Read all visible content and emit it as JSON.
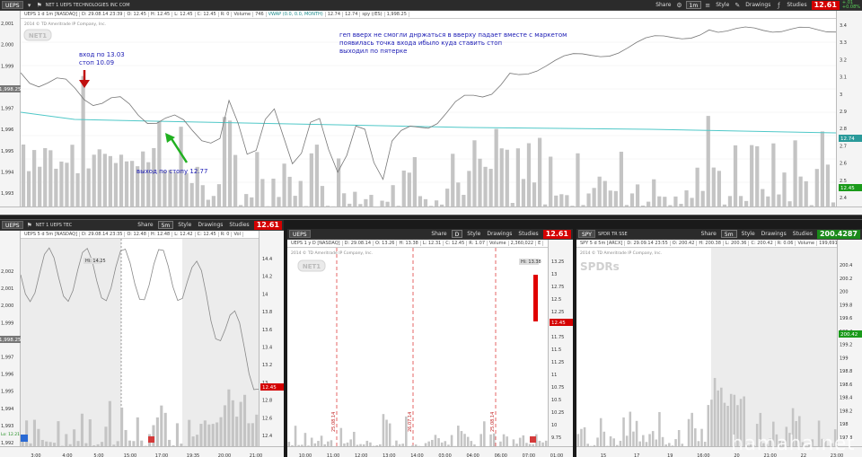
{
  "colors": {
    "up": "#10c010",
    "down": "#e00000",
    "price_tag": "#d40000",
    "mav": "#50c8c8",
    "annotation": "#1a1ab4",
    "arrow_red": "#c01010",
    "arrow_green": "#20b020"
  },
  "main": {
    "toolbar": {
      "symbol": "UEPS",
      "name": "NET 1 UEPS TECHNOLOGIES INC COM",
      "share": "Share",
      "aggregation": "1m",
      "style": "Style",
      "drawings": "Drawings",
      "studies": "Studies",
      "price": "12.61",
      "change": "+.01",
      "change_pct": "+0.08%"
    },
    "infobar": [
      "UEPS 1 d 1m [NASDAQ]",
      "D: 29.08.14 23:39",
      "O: 12.45",
      "H: 12.45",
      "L: 12.45",
      "C: 12.45",
      "R: 0",
      "Volume",
      "746",
      "VWAP (0.0, 0.0, MONTH)",
      "12.74",
      "12.74",
      "spy (/ES)",
      "1,998.25"
    ],
    "logo": "NET1",
    "copyright": "2014 © TD Ameritrade IP Company, Inc.",
    "left_ticks": [
      "2,001",
      "2,000",
      "1,999",
      "1,998",
      "1,997",
      "1,996",
      "1,995",
      "1,994",
      "1,993"
    ],
    "left_tag": "1,998.25",
    "right_ticks": [
      "3.4",
      "3.3",
      "3.2",
      "3.1",
      "3",
      "2.9",
      "2.8",
      "2.7",
      "2.6",
      "2.5",
      "2.4"
    ],
    "mav_tag": "12.74",
    "price_tag": "12.45",
    "time_ticks": [
      "19:35",
      "19:40",
      "19:45",
      "19:50",
      "19:55",
      "20:00",
      "20:05",
      "20:10",
      "20:15",
      "20:20",
      "20:25",
      "20:30",
      "20:35",
      "20:40",
      "20:45",
      "20:50",
      "20:55",
      "21:00",
      "21:05",
      "21:10",
      "21:15",
      "21:20",
      "21:25",
      "21:30",
      "21:35",
      "21:40",
      "21:45",
      "21:50",
      "21:55"
    ],
    "note_entry": [
      "вход по 13.03",
      "стоп 10.09"
    ],
    "note_top": [
      "геп вверх не смогли днржаться в вверху падает вместе с маркетом",
      "появилась точка входа ибыло куда ставить стоп",
      "выходил по пятерке"
    ],
    "note_exit": "выход по стопу 12.77"
  },
  "panel1": {
    "toolbar": {
      "symbol": "UEPS",
      "name": "NET 1 UEPS TEC",
      "share": "Share",
      "aggregation": "5m",
      "style": "Style",
      "drawings": "Drawings",
      "studies": "Studies",
      "price": "12.61"
    },
    "infobar": [
      "UEPS 5 d 5m [NASDAQ]",
      "D: 29.08.14 23:35",
      "O: 12.48",
      "H: 12.48",
      "L: 12.42",
      "C: 12.45",
      "R: 0",
      "Vol"
    ],
    "copyright": "2014 © TD Ameritrade IP Company, Inc.",
    "logo": "NET1",
    "left_ticks": [
      "2,002",
      "2,001",
      "2,000",
      "1,999",
      "1,998",
      "1,997",
      "1,996",
      "1,995",
      "1,994",
      "1,993",
      "1,992"
    ],
    "left_tag": "1,998.25",
    "right_ticks": [
      "14.4",
      "14.2",
      "14",
      "13.8",
      "13.6",
      "13.4",
      "13.2",
      "13",
      "12.8",
      "12.6",
      "12.4"
    ],
    "hi_label": "Hi: 14.25",
    "price_tag": "12.45",
    "time_ticks": [
      "3:00",
      "4:00",
      "5:00",
      "15:00",
      "17:00",
      "19:35",
      "20:00",
      "21:00"
    ],
    "bottom_label": "Lo: 12.21"
  },
  "panel2": {
    "toolbar": {
      "symbol": "UEPS",
      "share": "Share",
      "aggregation": "D",
      "style": "Style",
      "drawings": "Drawings",
      "studies": "Studies",
      "price": "12.61"
    },
    "infobar": [
      "UEPS 1 y D [NASDAQ]",
      "D: 29.08.14",
      "O: 13.26",
      "H: 13.38",
      "L: 12.31",
      "C: 12.45",
      "R: 1.07",
      "Volume",
      "2,360,022",
      "E"
    ],
    "copyright": "2014 © TD Ameritrade IP Company, Inc.",
    "logo": "NET1",
    "right_ticks": [
      "13.25",
      "13",
      "12.75",
      "12.5",
      "12.25",
      "12",
      "11.75",
      "11.5",
      "11.25",
      "11",
      "10.75",
      "10.5",
      "10.25",
      "10",
      "9.75"
    ],
    "hi_label": "Hi: 13.38",
    "price_tag": "12.45",
    "time_ticks": [
      "10:00",
      "11:00",
      "12:00",
      "13:00",
      "14:00",
      "03:00",
      "04:00",
      "06:00",
      "07:00",
      "01:00"
    ],
    "date_labels": [
      "25.08.14",
      "26.07.14",
      "25.08.14"
    ]
  },
  "panel3": {
    "toolbar": {
      "symbol": "SPY",
      "name": "SPDR TR SSE",
      "share": "Share",
      "aggregation": "5m",
      "style": "Style",
      "drawings": "Drawings",
      "studies": "Studies",
      "price": "200.4287",
      "change": "+.597",
      "change_pct": "+0.30%"
    },
    "infobar": [
      "SPY 5 d 5m [ARCX]",
      "D: 29.09.14 23:55",
      "O: 200.42",
      "H: 200.38",
      "L: 200.36",
      "C: 200.42",
      "R: 0.06",
      "Volume",
      "199,691"
    ],
    "copyright": "2014 © TD Ameritrade IP Company, Inc.",
    "logo": "SPDRs",
    "right_ticks": [
      "200.4",
      "200.2",
      "200",
      "199.8",
      "199.6",
      "199.4",
      "199.2",
      "199",
      "198.8",
      "198.6",
      "198.4",
      "198.2",
      "198",
      "197.8"
    ],
    "price_tag": "200.42",
    "time_ticks": [
      "15",
      "17",
      "19",
      "16:00",
      "20",
      "21:00",
      "22",
      "23:00"
    ]
  },
  "watermark": "hamaha.net"
}
